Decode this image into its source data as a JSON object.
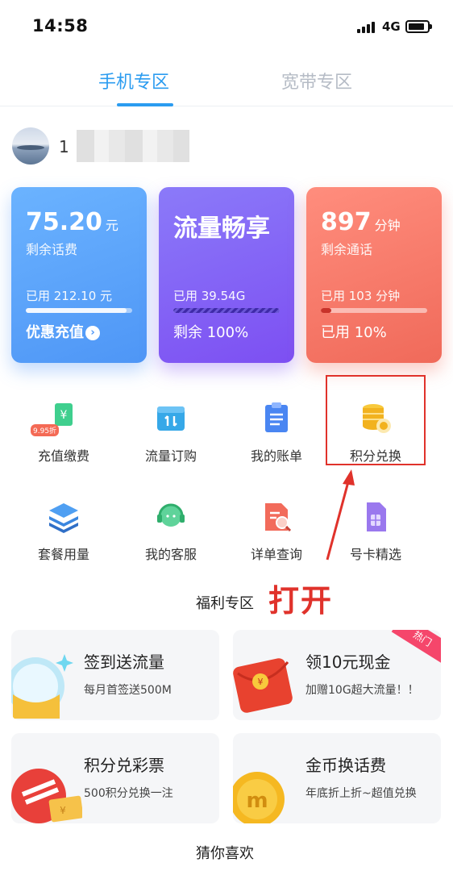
{
  "status_bar": {
    "time": "14:58",
    "network": "4G"
  },
  "tabs": [
    {
      "label": "手机专区",
      "active": true
    },
    {
      "label": "宽带专区",
      "active": false
    }
  ],
  "user": {
    "name_visible": "1"
  },
  "cards": [
    {
      "value": "75.20",
      "unit": "元",
      "subtitle": "剩余话费",
      "used": "已用 212.10 元",
      "progress": 0.95,
      "action": "优惠充值",
      "color": "#4e96f6"
    },
    {
      "value": "流量畅享",
      "unit": "",
      "subtitle": "",
      "used": "已用 39.54G",
      "progress": 1.0,
      "action": "剩余 100%",
      "color": "#7d4ff2"
    },
    {
      "value": "897",
      "unit": "分钟",
      "subtitle": "剩余通话",
      "used": "已用 103 分钟",
      "progress": 0.1,
      "action": "已用 10%",
      "color": "#f06a5a"
    }
  ],
  "services": [
    {
      "label": "充值缴费",
      "icon": "recharge-icon",
      "badge": "9.95折"
    },
    {
      "label": "流量订购",
      "icon": "data-order-icon"
    },
    {
      "label": "我的账单",
      "icon": "bill-icon"
    },
    {
      "label": "积分兑换",
      "icon": "coin-stack-icon"
    },
    {
      "label": "套餐用量",
      "icon": "layers-icon"
    },
    {
      "label": "我的客服",
      "icon": "headset-icon"
    },
    {
      "label": "详单查询",
      "icon": "document-search-icon"
    },
    {
      "label": "号卡精选",
      "icon": "sim-card-icon"
    }
  ],
  "annotation": {
    "text": "打开",
    "color": "#e0322b"
  },
  "welfare": {
    "title": "福利专区",
    "items": [
      {
        "title": "签到送流量",
        "desc": "每月首签送500M"
      },
      {
        "title": "领10元现金",
        "desc": "加赠10G超大流量！！",
        "tag": "热门"
      },
      {
        "title": "积分兑彩票",
        "desc": "500积分兑换一注"
      },
      {
        "title": "金币换话费",
        "desc": "年底折上折~超值兑换"
      }
    ]
  },
  "guess_title": "猜你喜欢"
}
